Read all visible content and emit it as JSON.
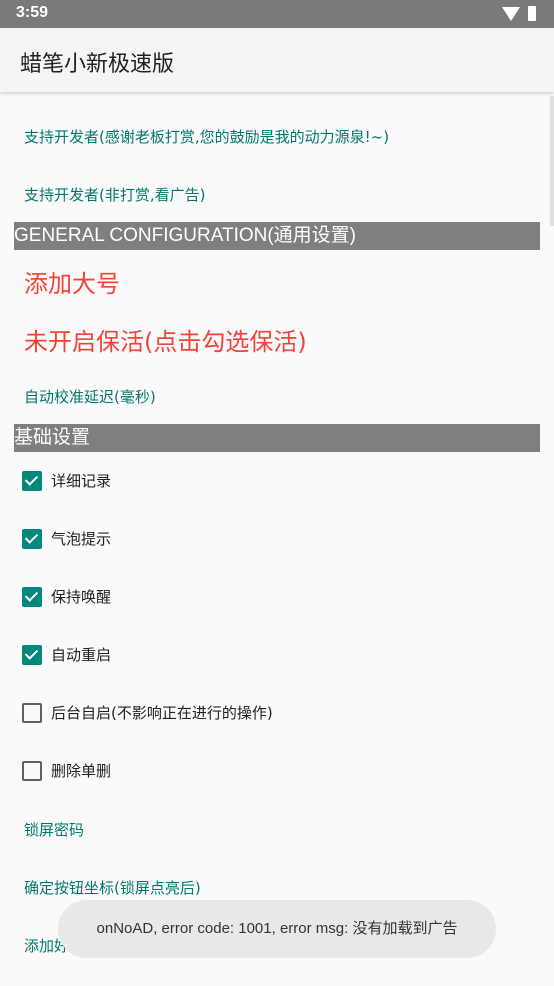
{
  "status_bar": {
    "time": "3:59"
  },
  "app_bar": {
    "title": "蜡笔小新极速版"
  },
  "items": {
    "support_donate": "支持开发者(感谢老板打赏,您的鼓励是我的动力源泉!~)",
    "support_ads": "支持开发者(非打赏,看广告)",
    "general_header": "GENERAL  CONFIGURATION(通用设置)",
    "add_main_account": "添加大号",
    "keepalive_off": "未开启保活(点击勾选保活)",
    "auto_calibrate_delay": "自动校准延迟(毫秒)",
    "basic_header": "基础设置",
    "lock_password": "锁屏密码",
    "confirm_button_coords": "确定按钮坐标(锁屏点亮后)",
    "add_friend_level": "添加好友等级"
  },
  "checkboxes": [
    {
      "label": "详细记录",
      "checked": true
    },
    {
      "label": "气泡提示",
      "checked": true
    },
    {
      "label": "保持唤醒",
      "checked": true
    },
    {
      "label": "自动重启",
      "checked": true
    },
    {
      "label": "后台自启(不影响正在进行的操作)",
      "checked": false
    },
    {
      "label": "删除单删",
      "checked": false
    }
  ],
  "toast": {
    "message": "onNoAD, error code: 1001, error msg: 没有加载到广告"
  },
  "colors": {
    "accent": "#00796b",
    "checkbox_on": "#00897b",
    "warning": "#f44336",
    "header_bg": "#7f7f7f"
  }
}
